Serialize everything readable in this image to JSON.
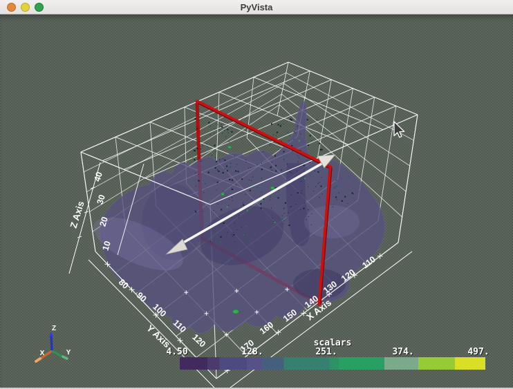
{
  "window": {
    "title": "PyVista",
    "controls": {
      "close": "close",
      "minimize": "minimize",
      "zoom": "zoom"
    }
  },
  "axes": {
    "x": {
      "title": "X Axis",
      "ticks": [
        "170",
        "160",
        "150",
        "140",
        "130",
        "120",
        "110"
      ]
    },
    "y": {
      "title": "Y Axis",
      "ticks": [
        "80",
        "90",
        "100",
        "110",
        "120"
      ]
    },
    "z": {
      "title": "Z Axis",
      "ticks": [
        "10",
        "20",
        "30",
        "40"
      ]
    }
  },
  "orientation_marker": {
    "x_label": "X",
    "y_label": "Y",
    "z_label": "Z",
    "x_color": "#cf6724",
    "y_color": "#2f9150",
    "z_color": "#2433cc"
  },
  "scalar_bar": {
    "title": "scalars",
    "labels": [
      "4.50",
      "128.",
      "251.",
      "374.",
      "497."
    ],
    "range": [
      4.5,
      497
    ],
    "gradient": [
      {
        "p": 0,
        "c": "#432a5e"
      },
      {
        "p": 9,
        "c": "#432a5e"
      },
      {
        "p": 9,
        "c": "#4b3a6e"
      },
      {
        "p": 13,
        "c": "#4b3a6e"
      },
      {
        "p": 13,
        "c": "#4d4a81"
      },
      {
        "p": 22,
        "c": "#4d4a81"
      },
      {
        "p": 22,
        "c": "#565289"
      },
      {
        "p": 27,
        "c": "#565289"
      },
      {
        "p": 27,
        "c": "#45607e"
      },
      {
        "p": 34,
        "c": "#45607e"
      },
      {
        "p": 34,
        "c": "#35806f"
      },
      {
        "p": 49,
        "c": "#35806f"
      },
      {
        "p": 49,
        "c": "#2f9166"
      },
      {
        "p": 52,
        "c": "#2f9166"
      },
      {
        "p": 52,
        "c": "#28a063"
      },
      {
        "p": 67,
        "c": "#28a063"
      },
      {
        "p": 67,
        "c": "#7aa98c"
      },
      {
        "p": 78,
        "c": "#7aa98c"
      },
      {
        "p": 78,
        "c": "#97cb35"
      },
      {
        "p": 90,
        "c": "#97cb35"
      },
      {
        "p": 90,
        "c": "#d8df25"
      },
      {
        "p": 100,
        "c": "#d8df25"
      }
    ]
  },
  "scene": {
    "background": "#515b52",
    "wireframe_color": "#ffffff",
    "surface_color": "#57517f",
    "plane_widget_color": "#c01010",
    "arrow_color": "#ffffff"
  }
}
